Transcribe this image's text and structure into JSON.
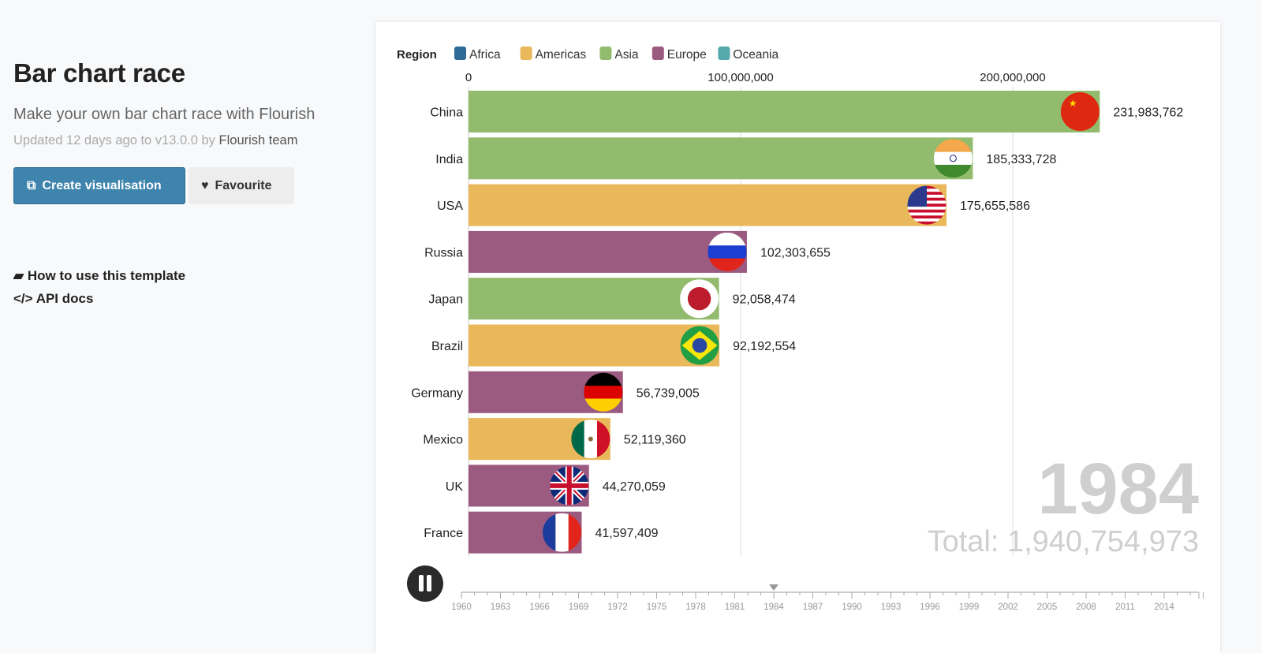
{
  "page": {
    "title": "Bar chart race",
    "subtitle": "Make your own bar chart race with Flourish",
    "updated_prefix": "Updated 12 days ago to v13.0.0 by",
    "author": "Flourish team",
    "create_label": "Create visualisation",
    "favourite_label": "Favourite",
    "howto_label": "How to use this template",
    "api_label": "API docs"
  },
  "chart_data": {
    "type": "bar",
    "orientation": "horizontal",
    "legend_title": "Region",
    "legend": [
      {
        "name": "Africa",
        "color": "#2d6a96"
      },
      {
        "name": "Americas",
        "color": "#e8b85a"
      },
      {
        "name": "Asia",
        "color": "#93bb6e"
      },
      {
        "name": "Europe",
        "color": "#9b5b80"
      },
      {
        "name": "Oceania",
        "color": "#55a9ab"
      }
    ],
    "xticks": [
      {
        "value": 0,
        "label": "0"
      },
      {
        "value": 100000000,
        "label": "100,000,000"
      },
      {
        "value": 200000000,
        "label": "200,000,000"
      }
    ],
    "xlim": [
      0,
      250000000
    ],
    "bars": [
      {
        "name": "China",
        "value": 231983762,
        "label": "231,983,762",
        "region": "Asia",
        "flag": "china"
      },
      {
        "name": "India",
        "value": 185333728,
        "label": "185,333,728",
        "region": "Asia",
        "flag": "india"
      },
      {
        "name": "USA",
        "value": 175655586,
        "label": "175,655,586",
        "region": "Americas",
        "flag": "usa"
      },
      {
        "name": "Russia",
        "value": 102303655,
        "label": "102,303,655",
        "region": "Europe",
        "flag": "russia"
      },
      {
        "name": "Japan",
        "value": 92058474,
        "label": "92,058,474",
        "region": "Asia",
        "flag": "japan"
      },
      {
        "name": "Brazil",
        "value": 92192554,
        "label": "92,192,554",
        "region": "Americas",
        "flag": "brazil"
      },
      {
        "name": "Germany",
        "value": 56739005,
        "label": "56,739,005",
        "region": "Europe",
        "flag": "germany"
      },
      {
        "name": "Mexico",
        "value": 52119360,
        "label": "52,119,360",
        "region": "Americas",
        "flag": "mexico"
      },
      {
        "name": "UK",
        "value": 44270059,
        "label": "44,270,059",
        "region": "Europe",
        "flag": "uk"
      },
      {
        "name": "France",
        "value": 41597409,
        "label": "41,597,409",
        "region": "Europe",
        "flag": "france"
      }
    ],
    "year": "1984",
    "total": "Total: 1,940,754,973",
    "timeline": {
      "start": 1960,
      "end": 2017,
      "current": 1984,
      "labels": [
        "1960",
        "1963",
        "1966",
        "1969",
        "1972",
        "1975",
        "1978",
        "1981",
        "1984",
        "1987",
        "1990",
        "1993",
        "1996",
        "1999",
        "2002",
        "2005",
        "2008",
        "2011",
        "2014"
      ]
    }
  }
}
